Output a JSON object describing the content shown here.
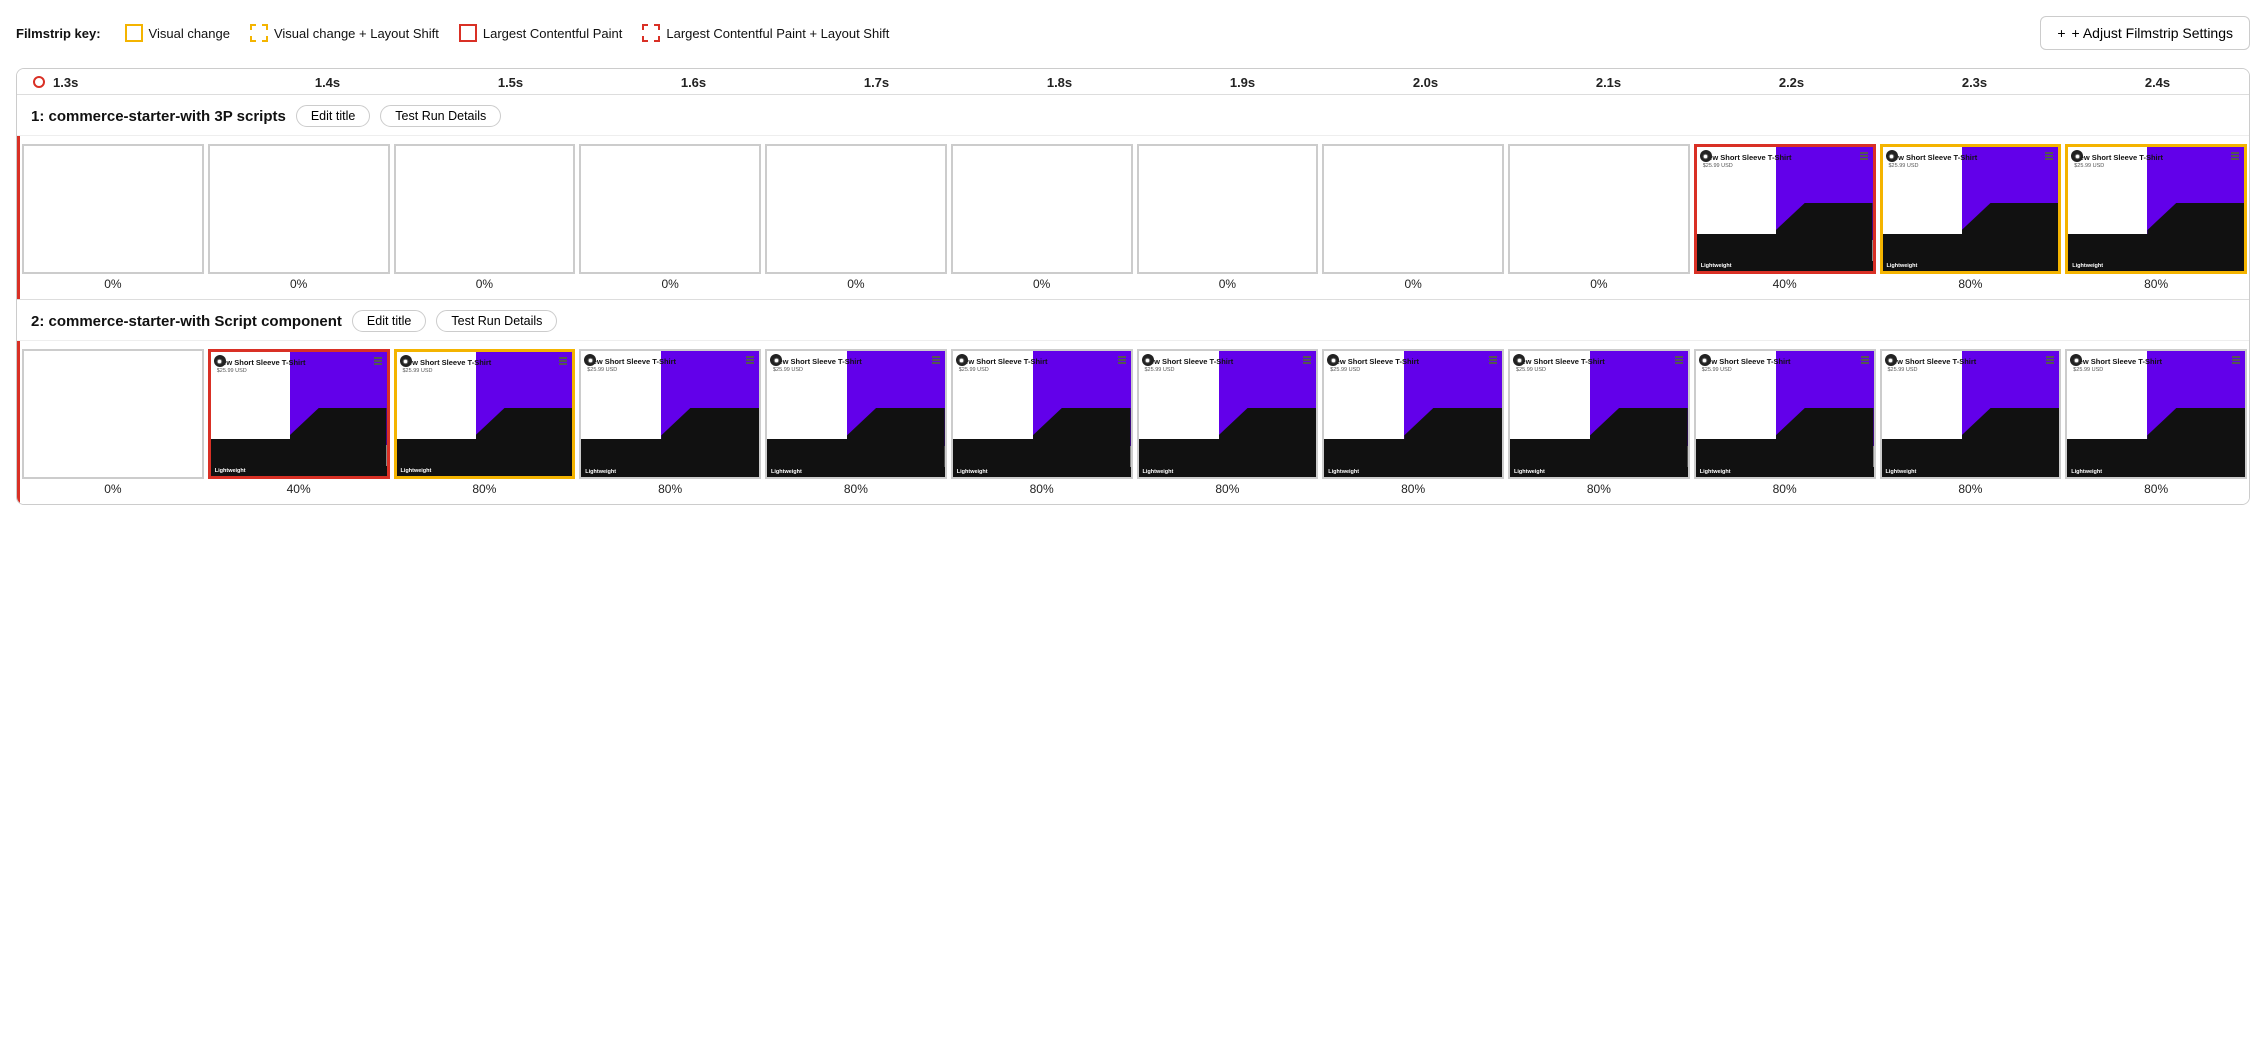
{
  "legend": {
    "label": "Filmstrip key:",
    "items": [
      {
        "id": "visual-change",
        "boxType": "yellow-solid",
        "text": "Visual change"
      },
      {
        "id": "visual-change-layout-shift",
        "boxType": "yellow-dashed",
        "text": "Visual change + Layout Shift"
      },
      {
        "id": "lcp",
        "boxType": "red-solid",
        "text": "Largest Contentful Paint"
      },
      {
        "id": "lcp-layout-shift",
        "boxType": "red-dashed",
        "text": "Largest Contentful Paint + Layout Shift"
      }
    ],
    "adjustButton": "+ Adjust Filmstrip Settings"
  },
  "timeline": {
    "ticks": [
      "1.3s",
      "1.4s",
      "1.5s",
      "1.6s",
      "1.7s",
      "1.8s",
      "1.9s",
      "2.0s",
      "2.1s",
      "2.2s",
      "2.3s",
      "2.4s"
    ]
  },
  "rows": [
    {
      "id": "row1",
      "title": "1: commerce-starter-with 3P scripts",
      "editTitleLabel": "Edit title",
      "testRunLabel": "Test Run Details",
      "frames": [
        {
          "type": "empty",
          "border": "none",
          "pct": "0%"
        },
        {
          "type": "empty",
          "border": "none",
          "pct": "0%"
        },
        {
          "type": "empty",
          "border": "none",
          "pct": "0%"
        },
        {
          "type": "empty",
          "border": "none",
          "pct": "0%"
        },
        {
          "type": "empty",
          "border": "none",
          "pct": "0%"
        },
        {
          "type": "empty",
          "border": "none",
          "pct": "0%"
        },
        {
          "type": "empty",
          "border": "none",
          "pct": "0%"
        },
        {
          "type": "empty",
          "border": "none",
          "pct": "0%"
        },
        {
          "type": "empty",
          "border": "none",
          "pct": "0%"
        },
        {
          "type": "shirt",
          "border": "border-red",
          "pct": "40%"
        },
        {
          "type": "shirt",
          "border": "border-yellow",
          "pct": "80%"
        },
        {
          "type": "shirt",
          "border": "border-yellow",
          "pct": "80%"
        }
      ]
    },
    {
      "id": "row2",
      "title": "2: commerce-starter-with Script component",
      "editTitleLabel": "Edit title",
      "testRunLabel": "Test Run Details",
      "frames": [
        {
          "type": "empty",
          "border": "none",
          "pct": "0%"
        },
        {
          "type": "shirt",
          "border": "border-red",
          "pct": "40%"
        },
        {
          "type": "shirt",
          "border": "border-yellow",
          "pct": "80%"
        },
        {
          "type": "shirt",
          "border": "none",
          "pct": "80%"
        },
        {
          "type": "shirt",
          "border": "none",
          "pct": "80%"
        },
        {
          "type": "shirt",
          "border": "none",
          "pct": "80%"
        },
        {
          "type": "shirt",
          "border": "none",
          "pct": "80%"
        },
        {
          "type": "shirt",
          "border": "none",
          "pct": "80%"
        },
        {
          "type": "shirt",
          "border": "none",
          "pct": "80%"
        },
        {
          "type": "shirt",
          "border": "none",
          "pct": "80%"
        },
        {
          "type": "shirt",
          "border": "none",
          "pct": "80%"
        },
        {
          "type": "shirt",
          "border": "none",
          "pct": "80%"
        }
      ]
    }
  ]
}
